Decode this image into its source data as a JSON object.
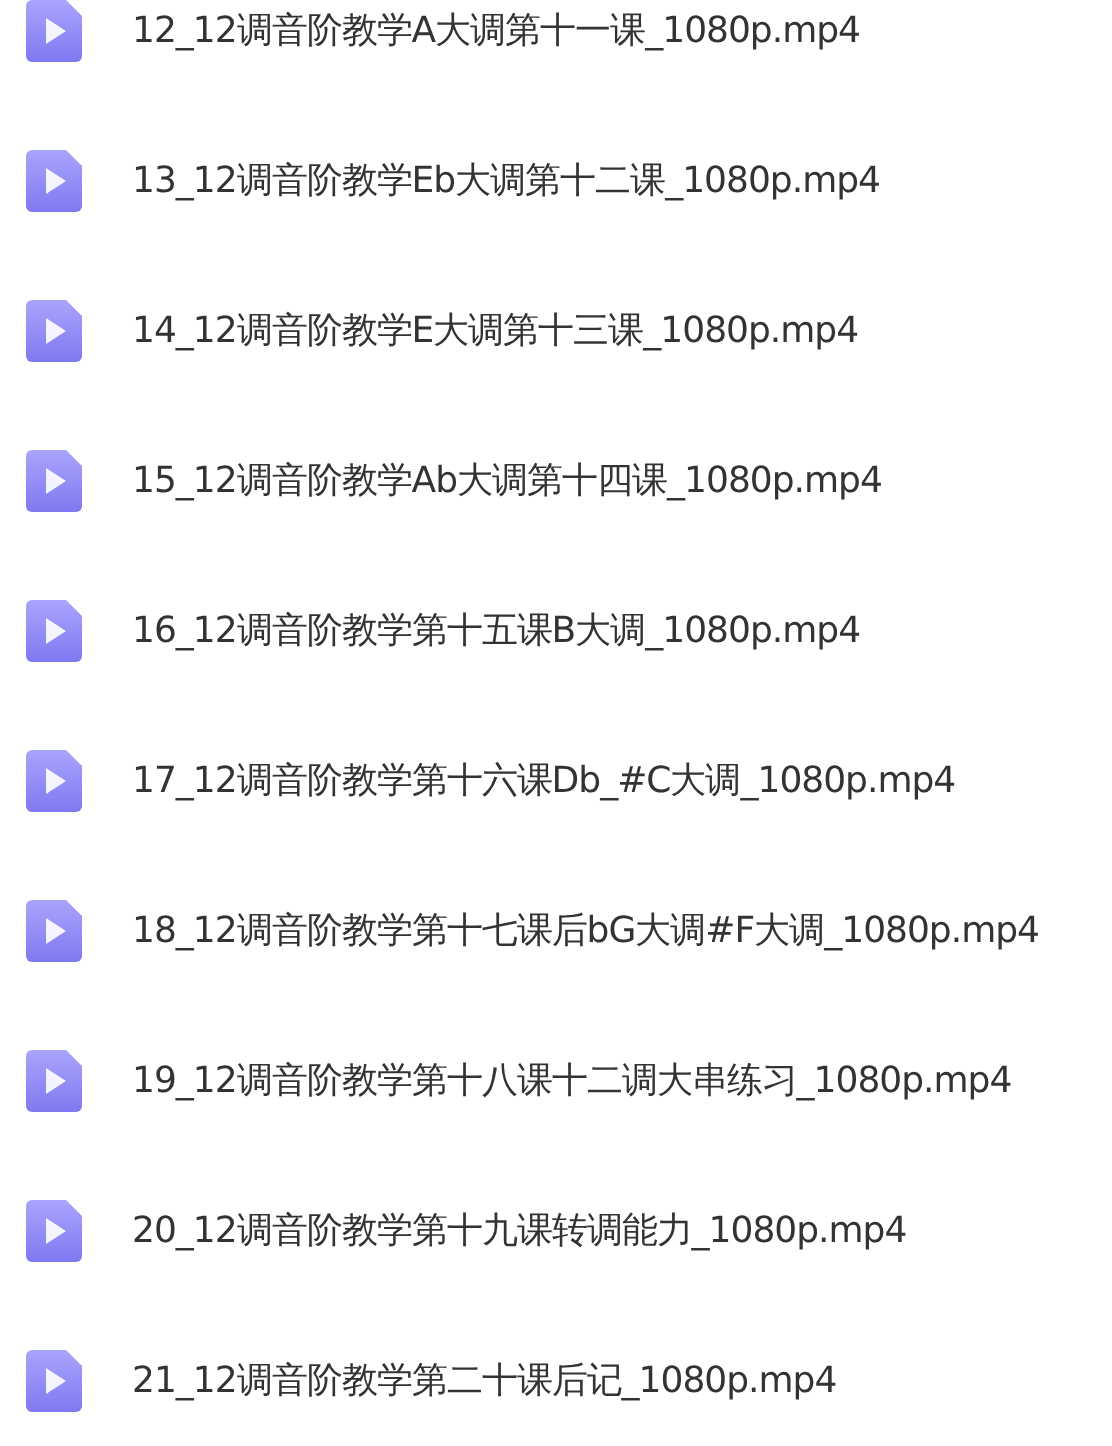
{
  "files": [
    {
      "name": "12_12调音阶教学A大调第十一课_1080p.mp4"
    },
    {
      "name": "13_12调音阶教学Eb大调第十二课_1080p.mp4"
    },
    {
      "name": "14_12调音阶教学E大调第十三课_1080p.mp4"
    },
    {
      "name": "15_12调音阶教学Ab大调第十四课_1080p.mp4"
    },
    {
      "name": "16_12调音阶教学第十五课B大调_1080p.mp4"
    },
    {
      "name": "17_12调音阶教学第十六课Db_#C大调_1080p.mp4"
    },
    {
      "name": "18_12调音阶教学第十七课后bG大调#F大调_1080p.mp4"
    },
    {
      "name": "19_12调音阶教学第十八课十二调大串练习_1080p.mp4"
    },
    {
      "name": "20_12调音阶教学第十九课转调能力_1080p.mp4"
    },
    {
      "name": "21_12调音阶教学第二十课后记_1080p.mp4"
    }
  ]
}
